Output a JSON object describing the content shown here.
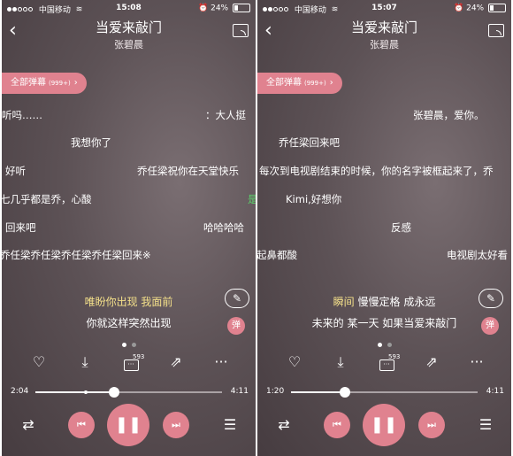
{
  "screens": [
    {
      "status": {
        "carrier": "中国移动",
        "time": "15:08",
        "battery": "24%"
      },
      "header": {
        "title": "当爱来敲门",
        "artist": "张碧晨"
      },
      "danmaku_button": {
        "label": "全部弹幕",
        "count": "(999+)"
      },
      "danmaku": [
        "听吗……",
        "：大人挺",
        "我想你了",
        "好听",
        "乔任梁祝你在天堂快乐",
        "七几乎都是乔，心酸",
        "是",
        "回来吧",
        "哈哈哈哈",
        "乔任梁乔任梁乔任梁乔任梁回来※"
      ],
      "lyrics": {
        "current_highlight": "唯盼你出现 我面前",
        "current_rest": "",
        "next": "你就这样突然出现"
      },
      "dan_label": "弹",
      "comment_count": "593",
      "progress": {
        "current": "2:04",
        "total": "4:11",
        "played_fraction": 0.42,
        "buffered_fraction": 0.27
      }
    },
    {
      "status": {
        "carrier": "中国移动",
        "time": "15:07",
        "battery": "24%"
      },
      "header": {
        "title": "当爱来敲门",
        "artist": "张碧晨"
      },
      "danmaku_button": {
        "label": "全部弹幕",
        "count": "(999+)"
      },
      "danmaku": [
        "张碧晨，爱你。",
        "乔任梁回来吧",
        "每次到电视剧结束的时候，你的名字被框起来了，乔",
        "Kimi,好想你",
        "反感",
        "起鼻都酸",
        "电视剧太好看"
      ],
      "lyrics": {
        "current_highlight": "瞬间",
        "current_rest": " 慢慢定格 成永远",
        "next": "未来的 某一天 如果当爱来敲门"
      },
      "dan_label": "弹",
      "comment_count": "593",
      "progress": {
        "current": "1:20",
        "total": "4:11",
        "played_fraction": 0.29,
        "buffered_fraction": 0.27
      }
    }
  ],
  "icons": [
    "back-icon",
    "cast-icon",
    "heart-icon",
    "download-icon",
    "comment-icon",
    "share-icon",
    "more-icon",
    "shuffle-icon",
    "prev-icon",
    "pause-icon",
    "next-icon",
    "playlist-icon",
    "pen-icon"
  ],
  "colors": {
    "accent": "#e0828f",
    "highlight": "#f4e08a",
    "green_danmaku": "#5bd66b"
  }
}
